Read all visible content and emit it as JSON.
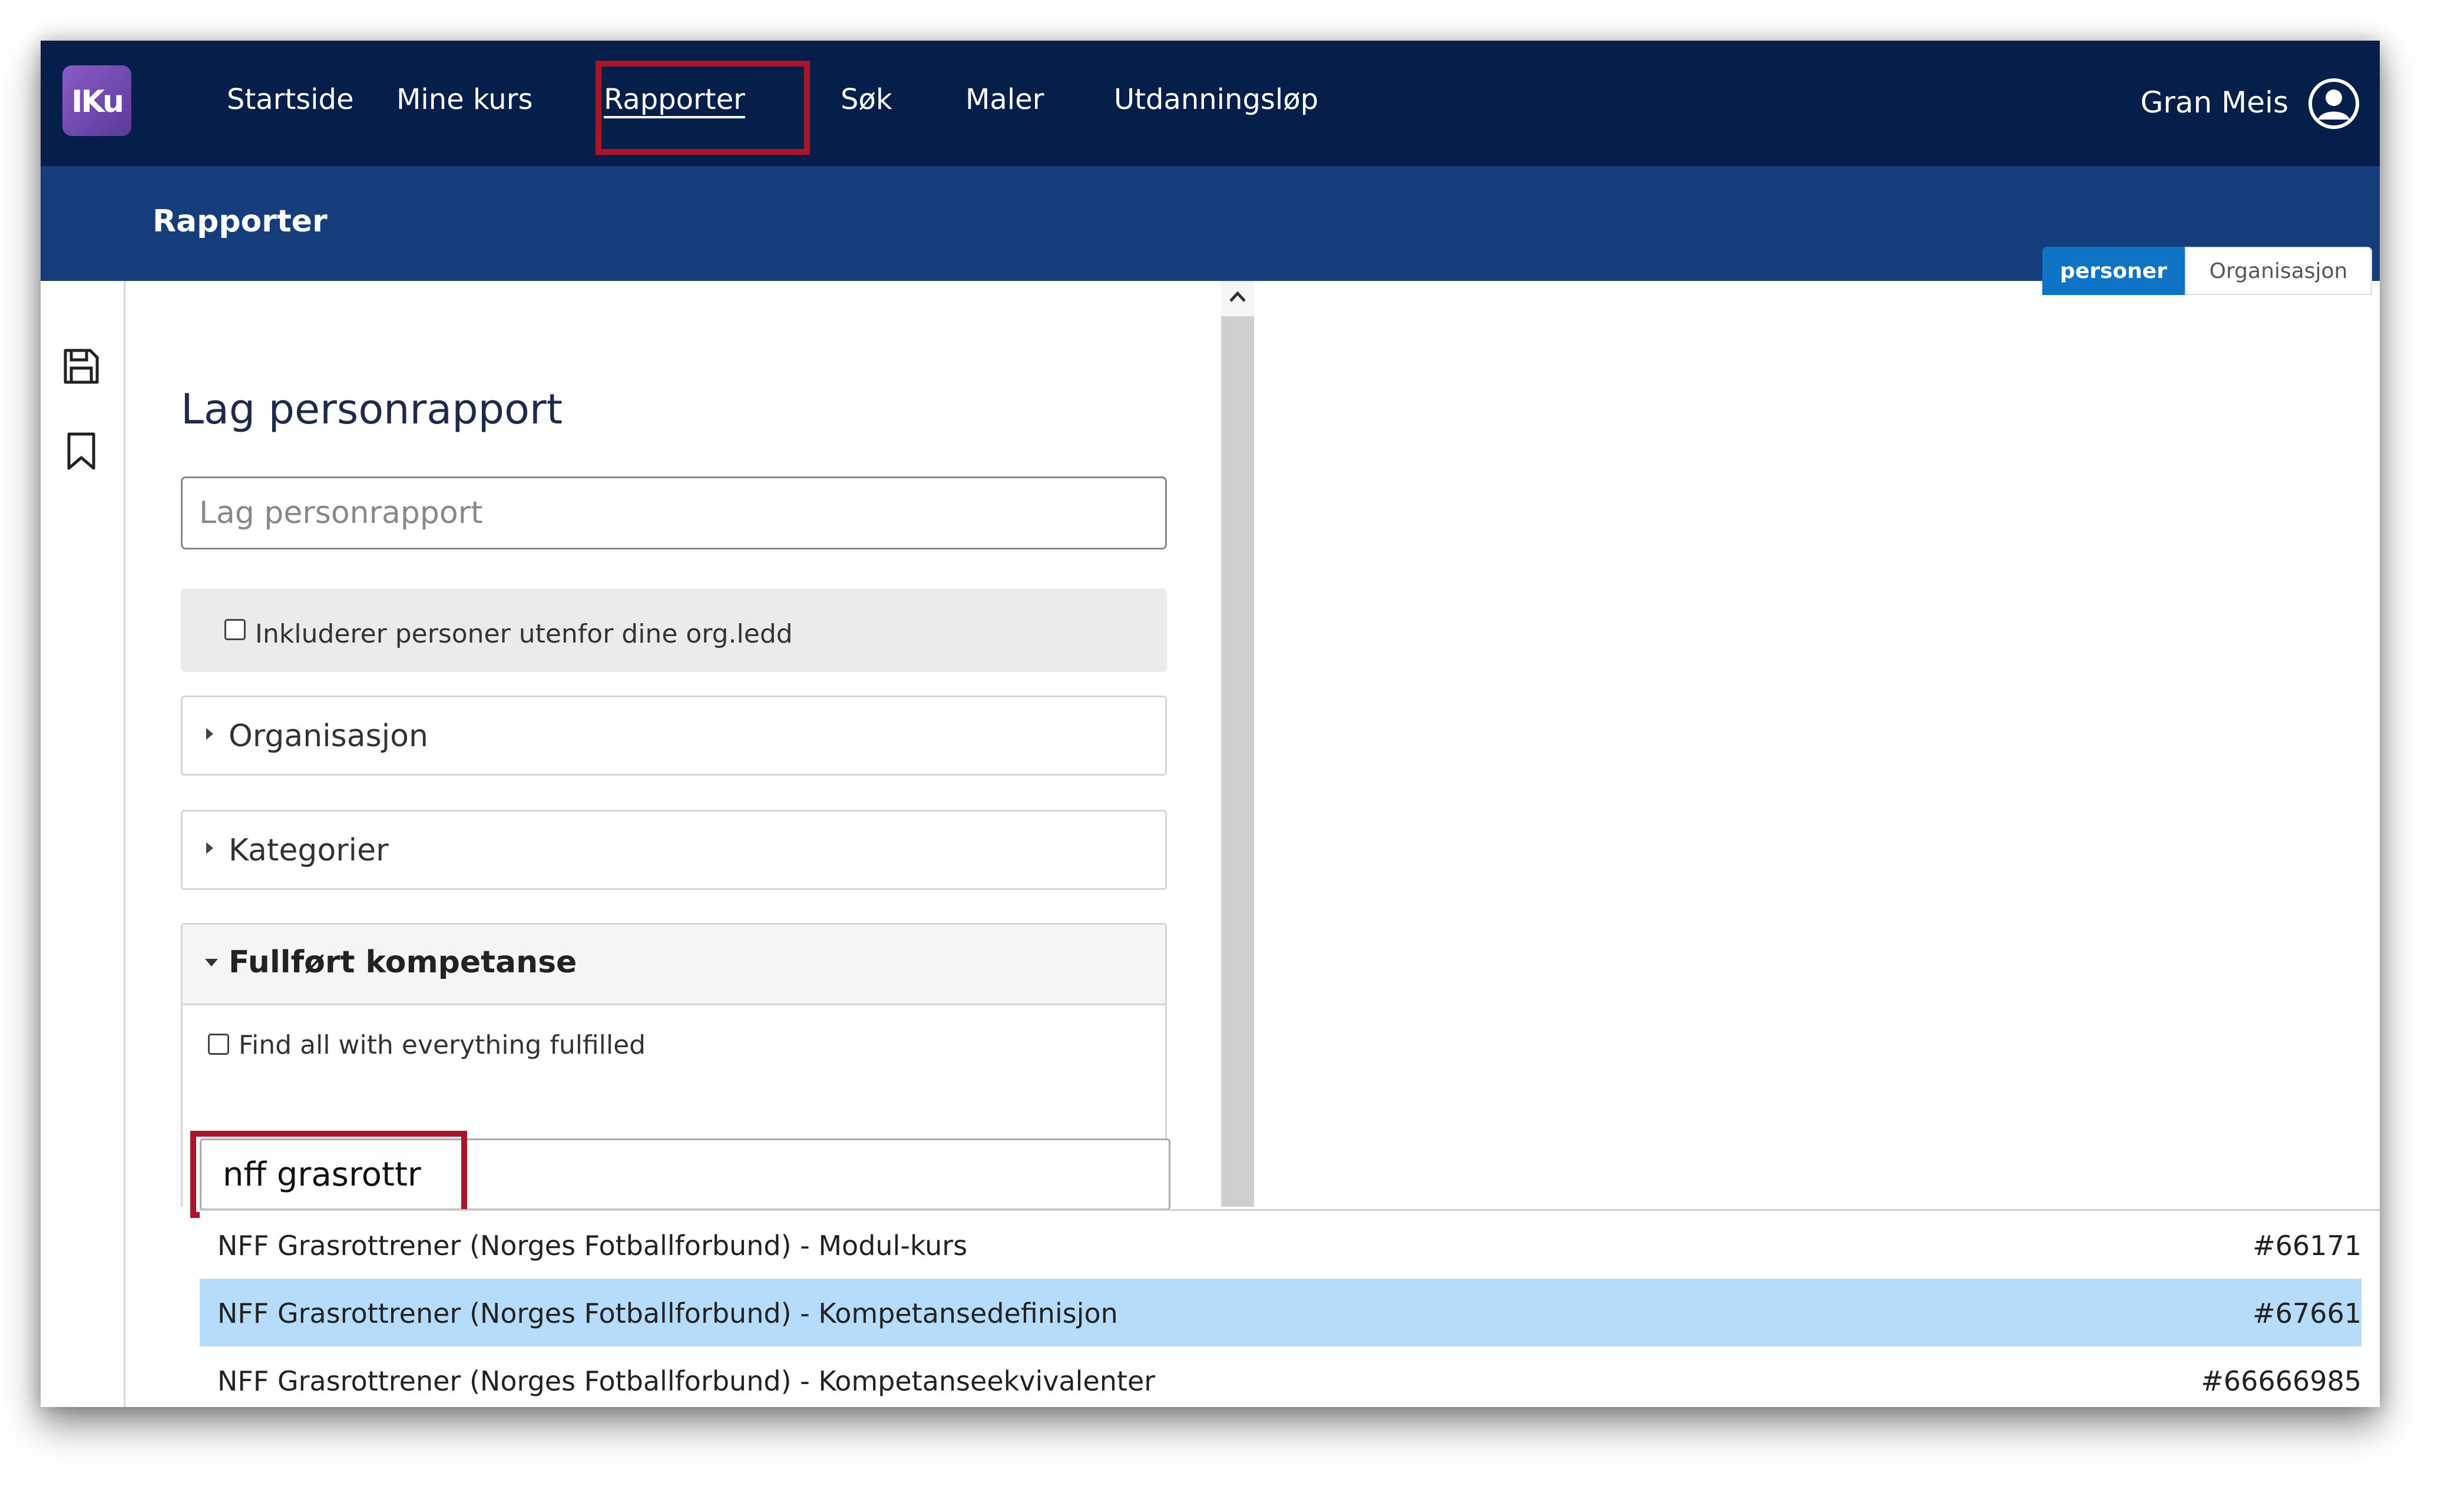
{
  "nav": {
    "logo_text": "IKu",
    "items": [
      "Startside",
      "Mine kurs",
      "Rapporter",
      "Søk",
      "Maler",
      "Utdanningsløp"
    ],
    "active": "Rapporter",
    "user_name": "Gran Meis"
  },
  "subbar": {
    "title": "Rapporter",
    "segments": [
      "personer",
      "Organisasjon"
    ],
    "selected_segment": "personer"
  },
  "sidebar": {
    "icons": [
      "save-icon",
      "bookmark-icon"
    ]
  },
  "form": {
    "title": "Lag personrapport",
    "name_placeholder": "Lag personrapport",
    "include_outside_label": "Inkluderer personer utenfor dine org.ledd",
    "accordions": [
      "Organisasjon",
      "Kategorier"
    ],
    "open_accordion": {
      "label": "Fullført kompetanse",
      "find_all_label": "Find all with everything fulfilled",
      "search_value": "nff grasrottr"
    }
  },
  "dropdown": {
    "items": [
      {
        "text": "NFF Grasrottrener (Norges Fotballforbund) - Modul-kurs",
        "id": "#66171",
        "highlighted": false
      },
      {
        "text": "NFF Grasrottrener (Norges Fotballforbund) - Kompetansedefinisjon",
        "id": "#67661",
        "highlighted": true
      },
      {
        "text": "NFF Grasrottrener (Norges Fotballforbund) - Kompetanseekvivalenter",
        "id": "#66666985",
        "highlighted": false
      }
    ]
  },
  "colors": {
    "topnav": "#061e4a",
    "subbar": "#163d7b",
    "accent": "#0f74c6",
    "highlight_box": "#a8162c",
    "row_highlight": "#b6dcfb"
  }
}
